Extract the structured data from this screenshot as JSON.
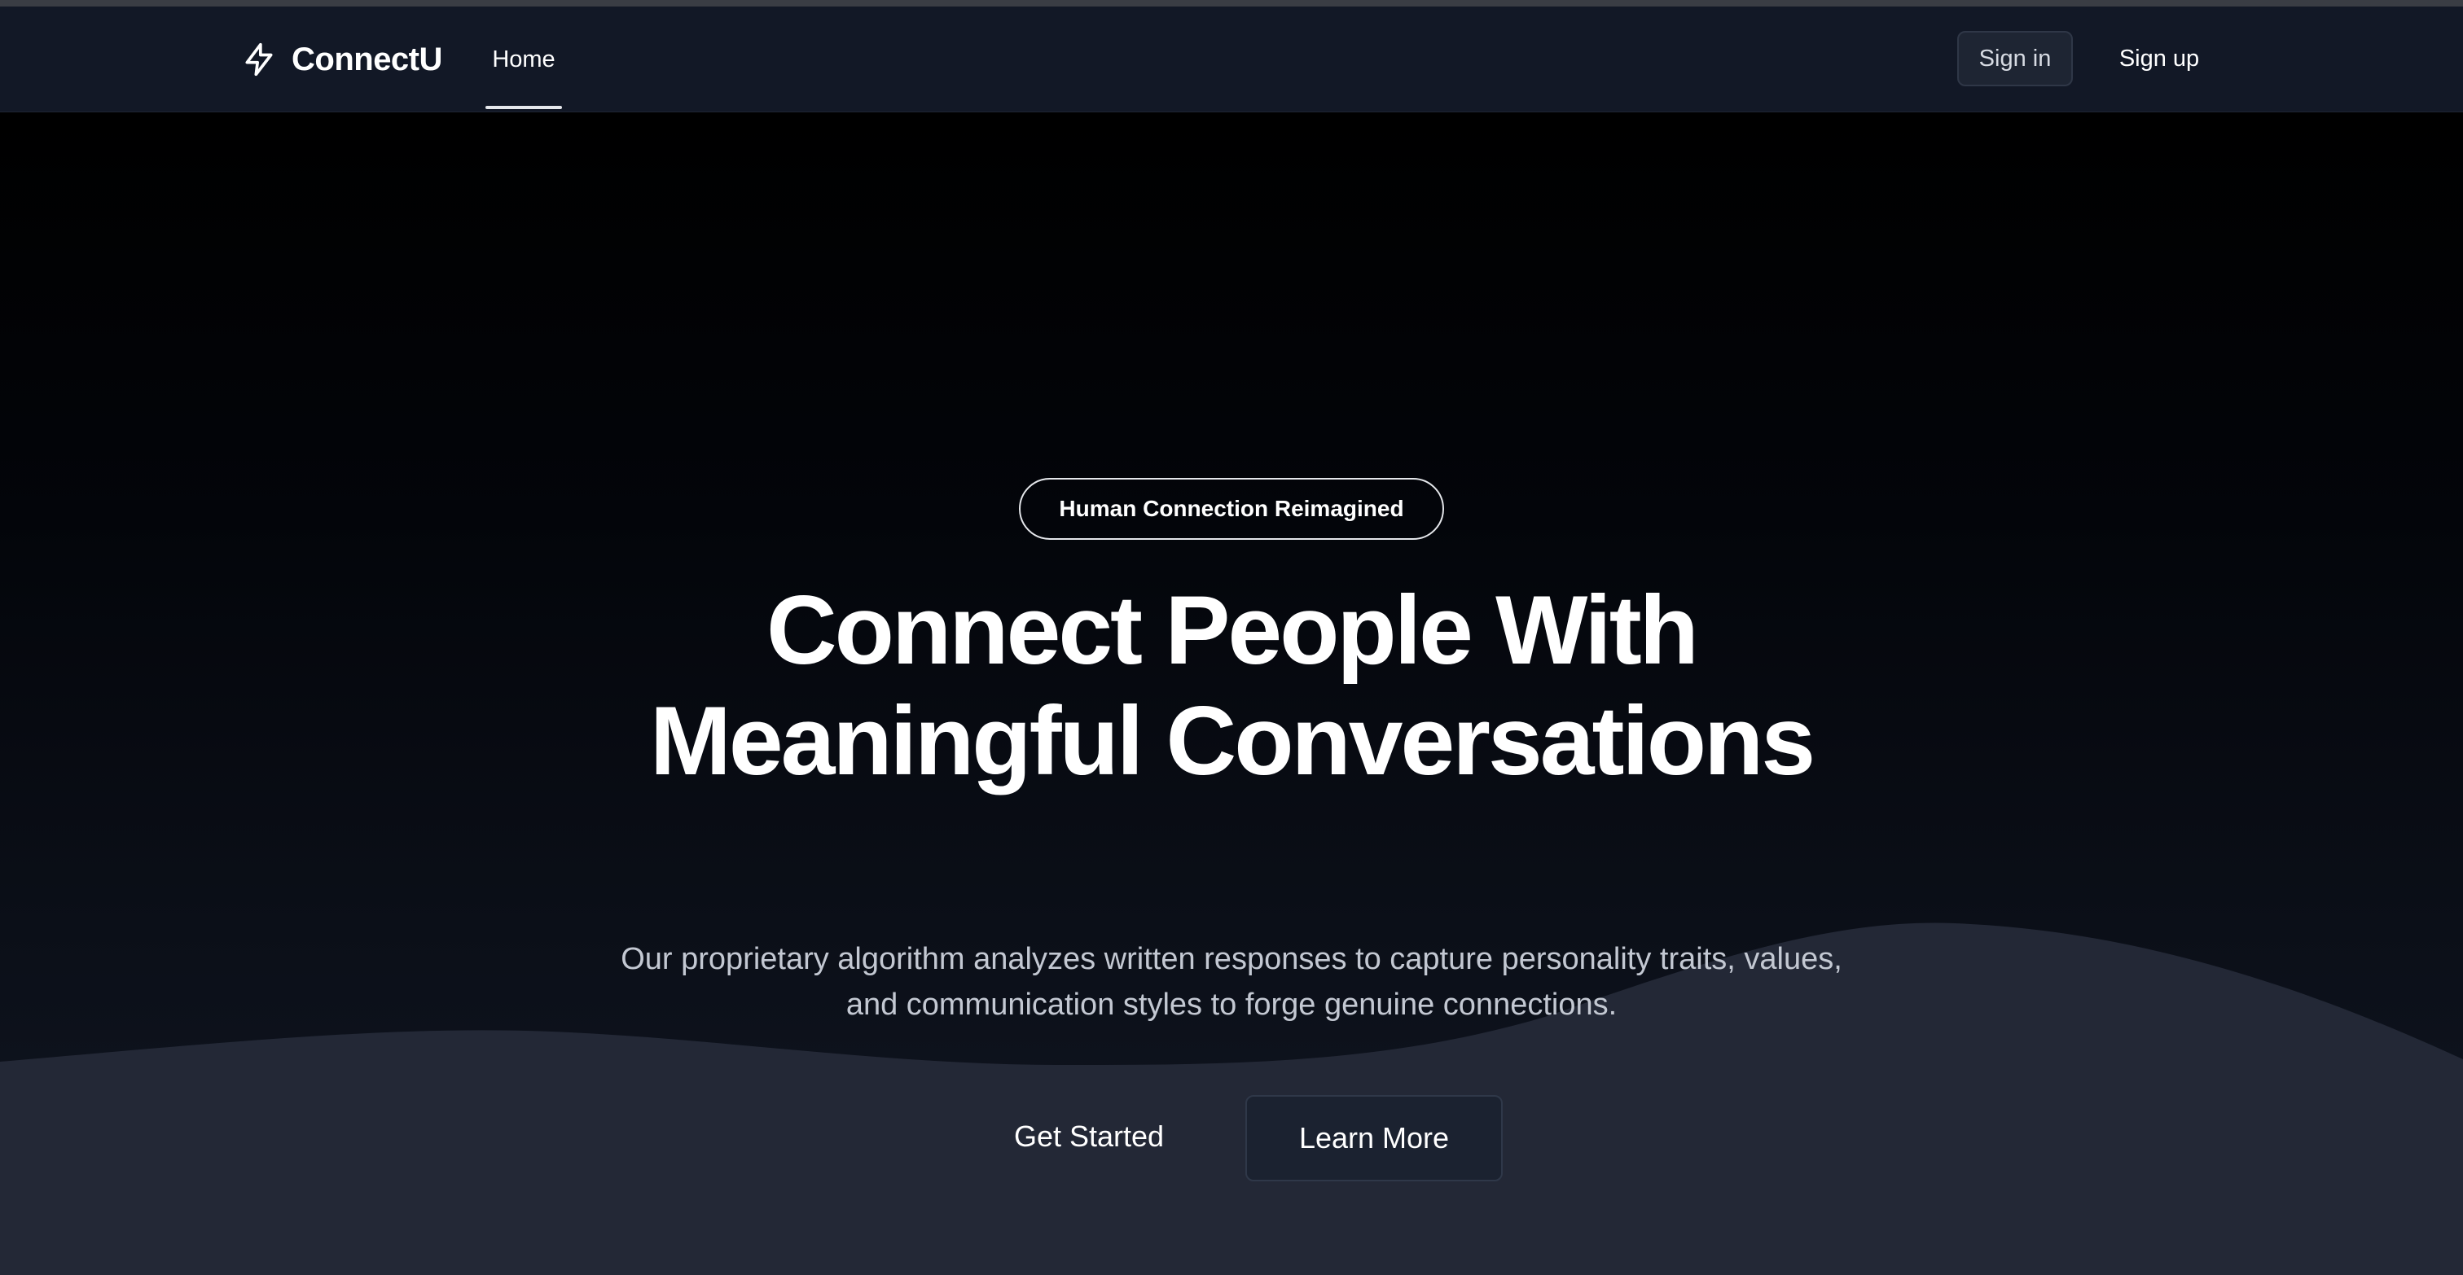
{
  "brand": {
    "name": "ConnectU",
    "icon": "lightning-bolt-icon"
  },
  "nav": {
    "items": [
      {
        "label": "Home",
        "active": true
      }
    ]
  },
  "auth": {
    "sign_in_label": "Sign in",
    "sign_up_label": "Sign up"
  },
  "hero": {
    "badge": "Human Connection Reimagined",
    "headline_line1": "Connect People With",
    "headline_line2": "Meaningful Conversations",
    "subtext": "Our proprietary algorithm analyzes written responses to capture personality traits, values, and communication styles to forge genuine connections.",
    "primary_cta": "Get Started",
    "secondary_cta": "Learn More"
  },
  "colors": {
    "navbar_bg": "#121826",
    "hero_bg": "#000000",
    "wave_fill": "#232836",
    "text_primary": "#ffffff",
    "text_muted": "#c3c8d2"
  }
}
